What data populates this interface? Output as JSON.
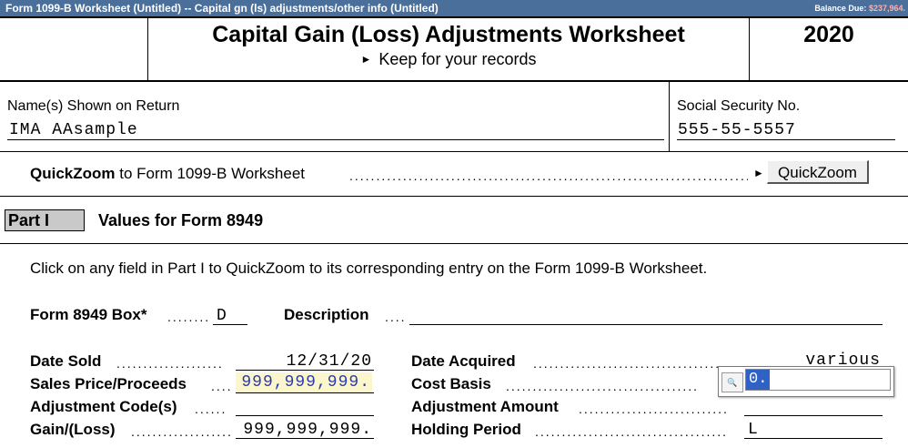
{
  "window": {
    "title": "Form 1099-B Worksheet (Untitled) -- Capital gn (ls) adjustments/other info (Untitled)",
    "balance_label": "Balance Due:",
    "balance_value": "$237,964."
  },
  "header": {
    "title": "Capital Gain (Loss) Adjustments Worksheet",
    "subtitle": "Keep for your records",
    "year": "2020"
  },
  "taxpayer": {
    "name_label": "Name(s) Shown on Return",
    "name_value": "IMA AAsample",
    "ssn_label": "Social Security No.",
    "ssn_value": "555-55-5557"
  },
  "quickzoom": {
    "bold": "QuickZoom",
    "text": " to Form 1099-B Worksheet",
    "button": "QuickZoom"
  },
  "part1": {
    "label": "Part I",
    "title": "Values for Form 8949",
    "instruction": "Click on any field in Part I to QuickZoom to its corresponding entry on the Form 1099-B Worksheet."
  },
  "fields": {
    "box_label": "Form 8949 Box*",
    "box_value": "D",
    "description_label": "Description",
    "description_value": "",
    "date_sold_label": "Date Sold",
    "date_sold_value": "12/31/20",
    "date_acquired_label": "Date Acquired",
    "date_acquired_value": "various",
    "sales_price_label": "Sales Price/Proceeds",
    "sales_price_value": "999,999,999.",
    "cost_basis_label": "Cost Basis",
    "cost_basis_value": "0.",
    "adj_code_label": "Adjustment Code(s)",
    "adj_code_value": "",
    "adj_amount_label": "Adjustment Amount",
    "adj_amount_value": "",
    "gain_label": "Gain/(Loss)",
    "gain_value": "999,999,999.",
    "holding_label": "Holding Period",
    "holding_value": "L"
  },
  "colors": {
    "titlebar": "#4a6f9a",
    "highlight_field": "#fbf6cc",
    "selection": "#2f62c4"
  }
}
